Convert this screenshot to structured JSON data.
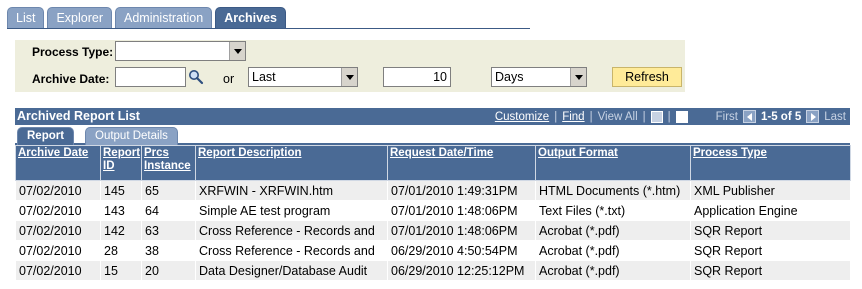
{
  "tabs": [
    "List",
    "Explorer",
    "Administration",
    "Archives"
  ],
  "active_tab": "Archives",
  "criteria": {
    "process_type_label": "Process Type:",
    "process_type_value": "",
    "archive_date_label": "Archive Date:",
    "archive_date_value": "",
    "or_label": "or",
    "range_value": "Last",
    "count_value": "10",
    "unit_value": "Days",
    "refresh_label": "Refresh"
  },
  "grid": {
    "title": "Archived Report List",
    "customize": "Customize",
    "find": "Find",
    "view_all": "View All",
    "first": "First",
    "range": "1-5 of 5",
    "last": "Last",
    "subtabs": [
      "Report",
      "Output Details"
    ],
    "columns": [
      "Archive Date",
      "Report ID",
      "Prcs Instance",
      "Report Description",
      "Request Date/Time",
      "Output Format",
      "Process Type"
    ],
    "rows": [
      [
        "07/02/2010",
        "145",
        "65",
        "XRFWIN - XRFWIN.htm",
        "07/01/2010  1:49:31PM",
        "HTML Documents (*.htm)",
        "XML Publisher"
      ],
      [
        "07/02/2010",
        "143",
        "64",
        "Simple AE test program",
        "07/01/2010  1:48:06PM",
        "Text Files (*.txt)",
        "Application Engine"
      ],
      [
        "07/02/2010",
        "142",
        "63",
        "Cross Reference - Records and",
        "07/01/2010  1:48:06PM",
        "Acrobat (*.pdf)",
        "SQR Report"
      ],
      [
        "07/02/2010",
        "28",
        "38",
        "Cross Reference - Records and",
        "06/29/2010  4:50:54PM",
        "Acrobat (*.pdf)",
        "SQR Report"
      ],
      [
        "07/02/2010",
        "15",
        "20",
        "Data Designer/Database Audit",
        "06/29/2010 12:25:12PM",
        "Acrobat (*.pdf)",
        "SQR Report"
      ]
    ]
  },
  "colors": {
    "header_blue": "#4a6a95",
    "tab_blue": "#8aa2c4",
    "panel_bg": "#eeeedd",
    "button_yellow": "#ffeb99"
  }
}
